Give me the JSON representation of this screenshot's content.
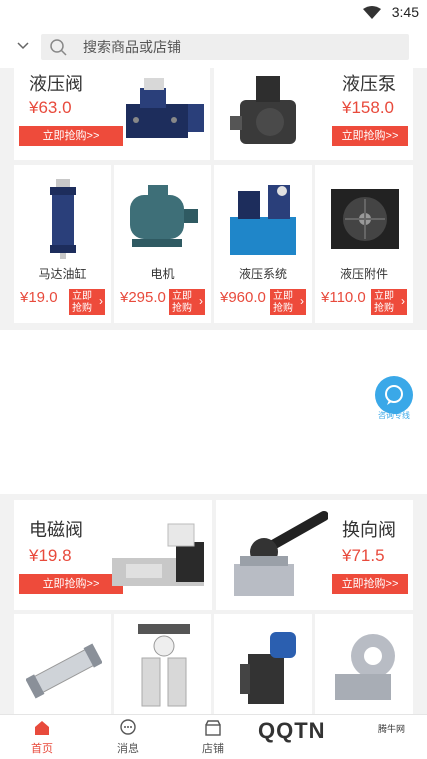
{
  "status": {
    "time": "3:45",
    "wifi_icon": "wifi-icon"
  },
  "search": {
    "placeholder": "搜索商品或店铺"
  },
  "section1": {
    "featured": [
      {
        "title": "液压阀",
        "price": "¥63.0",
        "button": "立即抢购>>"
      },
      {
        "title": "液压泵",
        "price": "¥158.0",
        "button": "立即抢购>>"
      }
    ],
    "items": [
      {
        "name": "马达油缸",
        "price": "¥19.0",
        "button": "立即抢购"
      },
      {
        "name": "电机",
        "price": "¥295.0",
        "button": "立即抢购"
      },
      {
        "name": "液压系统",
        "price": "¥960.0",
        "button": "立即抢购"
      },
      {
        "name": "液压附件",
        "price": "¥110.0",
        "button": "立即抢购"
      }
    ]
  },
  "float": {
    "label": "咨询专线"
  },
  "section2": {
    "featured": [
      {
        "title": "电磁阀",
        "price": "¥19.8",
        "button": "立即抢购>>"
      },
      {
        "title": "换向阀",
        "price": "¥71.5",
        "button": "立即抢购>>"
      }
    ]
  },
  "tabs": [
    {
      "label": "首页",
      "active": true
    },
    {
      "label": "消息",
      "active": false
    },
    {
      "label": "店铺",
      "active": false
    }
  ],
  "watermark": {
    "text": "QQTN",
    "sub": "腾牛网"
  },
  "colors": {
    "accent": "#e84a3c",
    "button": "#ee4b3b",
    "float": "#3aa8e8",
    "page_bg": "#f2f2f2"
  }
}
